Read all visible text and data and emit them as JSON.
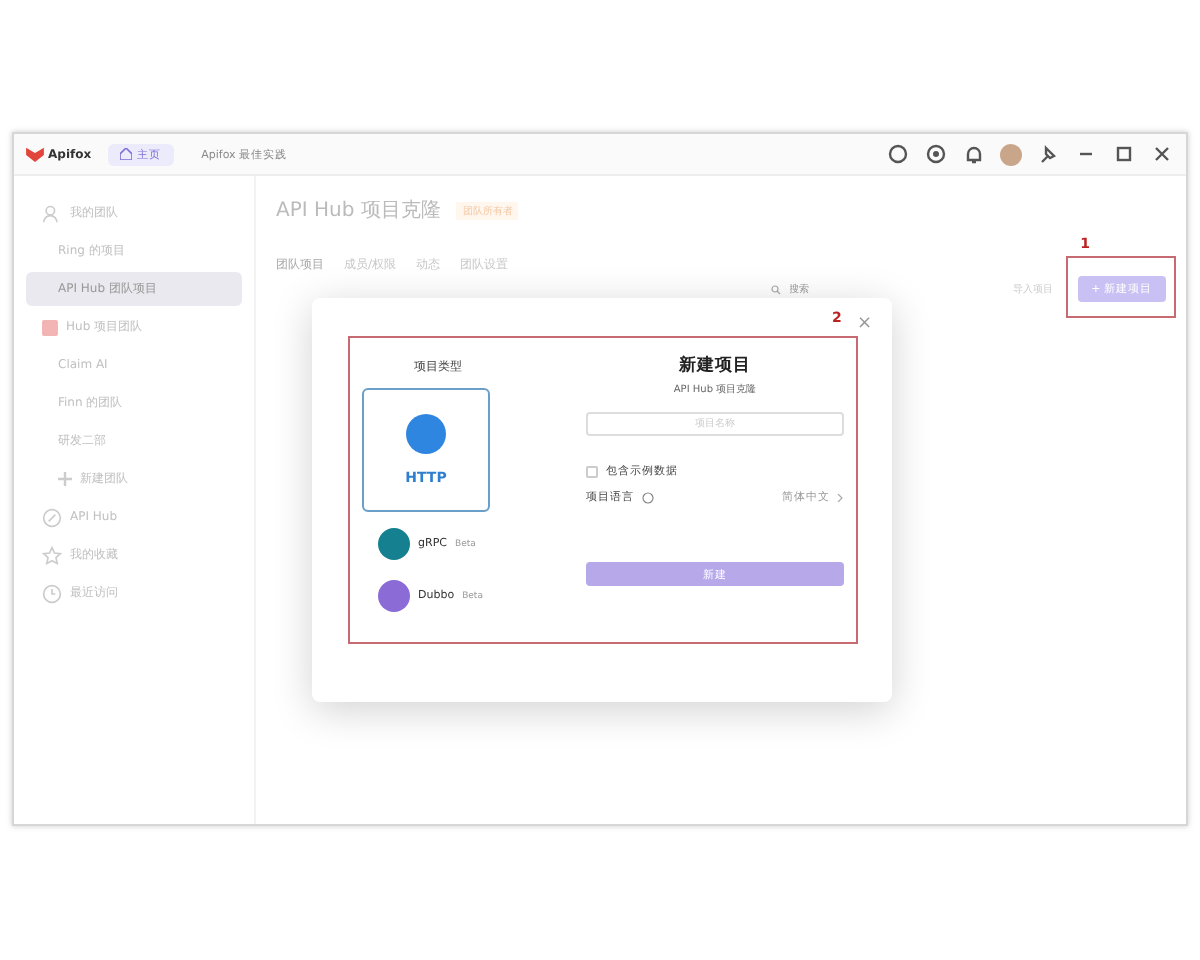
{
  "titlebar": {
    "logo": "Apifox",
    "tabs": [
      {
        "label": "主页",
        "selected": true
      },
      {
        "label": "Apifox 最佳实践",
        "selected": false
      }
    ]
  },
  "sidebar": {
    "items": [
      {
        "label": "我的团队",
        "kind": "group",
        "selected": false
      },
      {
        "label": "Ring 的项目",
        "kind": "team",
        "selected": false
      },
      {
        "label": "API Hub 团队项目",
        "kind": "team",
        "selected": true
      },
      {
        "label": "Hub 项目团队",
        "kind": "flagged",
        "selected": false
      },
      {
        "label": "Claim AI",
        "kind": "team",
        "selected": false
      },
      {
        "label": "Finn 的团队",
        "kind": "team",
        "selected": false
      },
      {
        "label": "研发二部",
        "kind": "team",
        "selected": false
      },
      {
        "label": "新建团队",
        "kind": "add",
        "selected": false
      },
      {
        "label": "API Hub",
        "kind": "hub",
        "selected": false
      },
      {
        "label": "我的收藏",
        "kind": "star",
        "selected": false
      },
      {
        "label": "最近访问",
        "kind": "clock",
        "selected": false
      }
    ]
  },
  "main": {
    "title": "API Hub 项目克隆",
    "badge": "团队所有者",
    "tabs": [
      {
        "label": "团队项目",
        "selected": true
      },
      {
        "label": "成员/权限",
        "selected": false
      },
      {
        "label": "动态",
        "selected": false
      },
      {
        "label": "团队设置",
        "selected": false
      }
    ],
    "search": {
      "placeholder": "搜索"
    },
    "import_button": "导入项目",
    "new_button": "+ 新建项目",
    "annotation": "1"
  },
  "dialog": {
    "annotation": "2",
    "close": "×",
    "type_heading": "项目类型",
    "types": [
      {
        "name": "HTTP",
        "selected": true,
        "kind": "http"
      },
      {
        "name": "gRPC",
        "tag": "Beta",
        "selected": false,
        "kind": "grpc"
      },
      {
        "name": "Dubbo",
        "tag": "Beta",
        "selected": false,
        "kind": "dubbo"
      }
    ],
    "title": "新建项目",
    "subtitle": "API Hub 项目克隆",
    "name_field": {
      "placeholder": "项目名称"
    },
    "sample_data": {
      "label": "包含示例数据",
      "checked": false
    },
    "language": {
      "label": "项目语言",
      "value": "简体中文"
    },
    "create_button": "新建"
  }
}
